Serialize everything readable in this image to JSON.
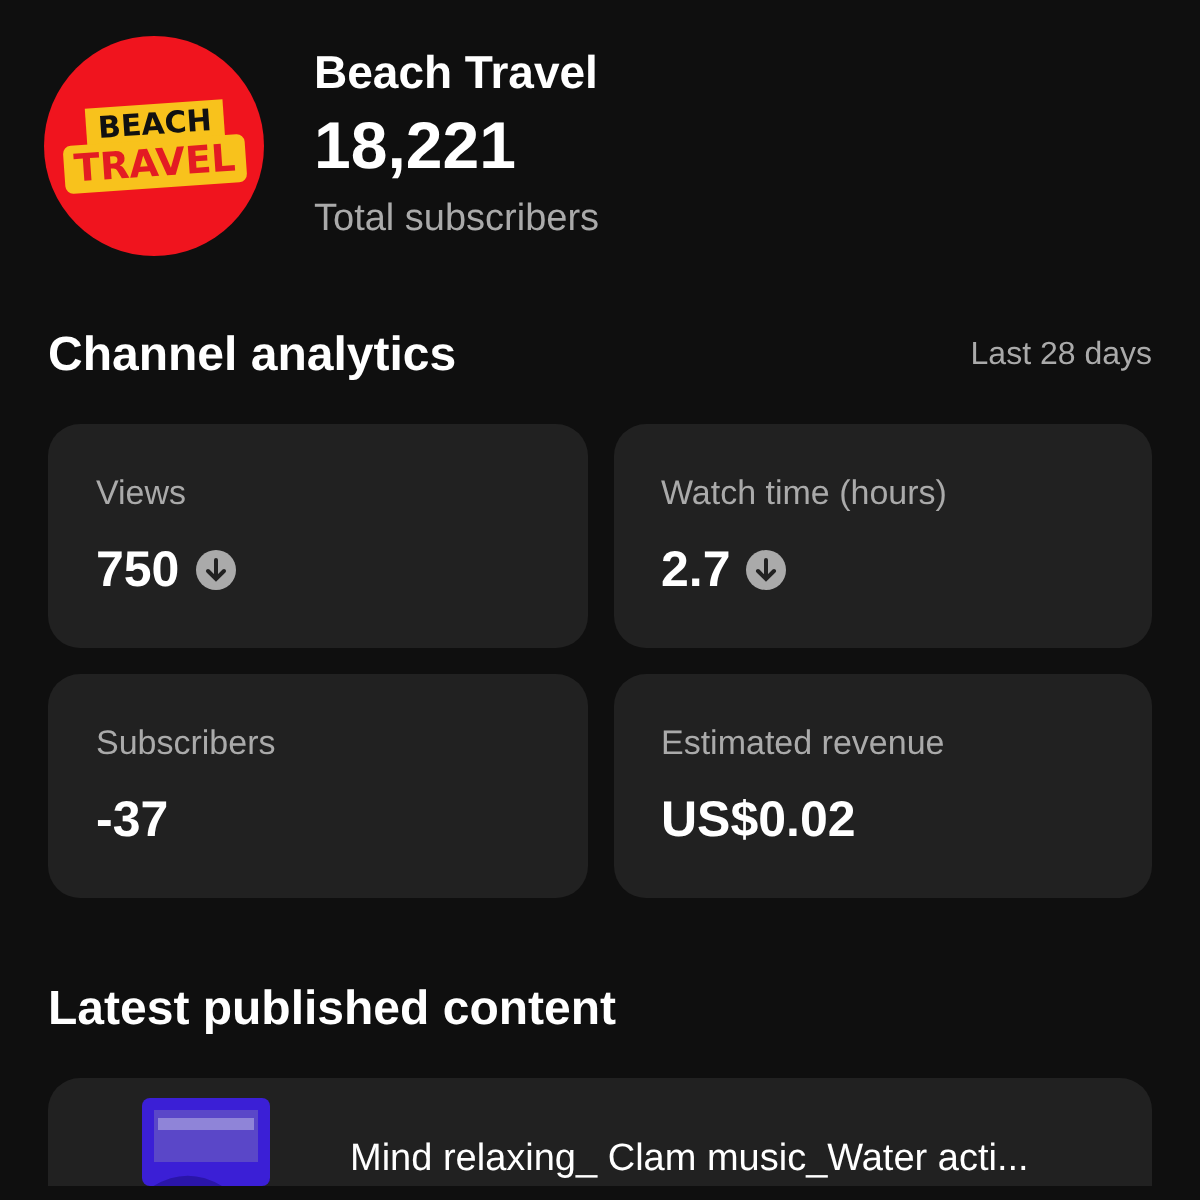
{
  "channel": {
    "logo_lines": [
      "BEACH",
      "TRAVEL"
    ],
    "name": "Beach Travel",
    "subscribers": "18,221",
    "subscribers_label": "Total subscribers"
  },
  "analytics": {
    "title": "Channel analytics",
    "period": "Last 28 days",
    "metrics": [
      {
        "label": "Views",
        "value": "750",
        "decreased": true
      },
      {
        "label": "Watch time (hours)",
        "value": "2.7",
        "decreased": true
      },
      {
        "label": "Subscribers",
        "value": "-37",
        "decreased": false
      },
      {
        "label": "Estimated revenue",
        "value": "US$0.02",
        "decreased": false
      }
    ]
  },
  "latest": {
    "title": "Latest published content",
    "items": [
      {
        "kind": "picture",
        "title": "Mind relaxing_ Clam music_Water acti..."
      }
    ]
  }
}
